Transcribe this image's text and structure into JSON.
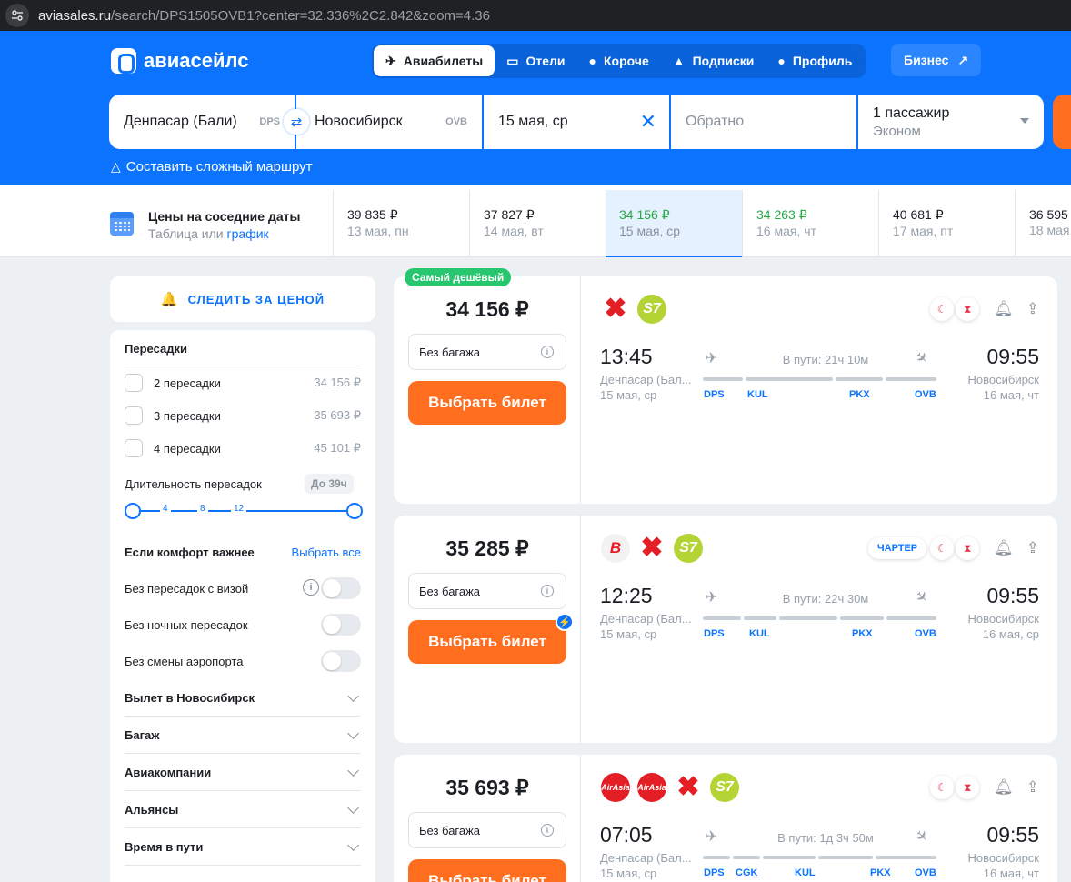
{
  "browser": {
    "domain": "aviasales.ru",
    "path": "/search/DPS1505OVB1?center=32.336%2C2.842&zoom=4.36"
  },
  "header": {
    "logo": "авиасейлс",
    "nav": [
      {
        "label": "Авиабилеты",
        "icon": "plane-icon"
      },
      {
        "label": "Отели",
        "icon": "bed-icon"
      },
      {
        "label": "Короче",
        "icon": "map-pin-icon"
      },
      {
        "label": "Подписки",
        "icon": "bell-icon"
      },
      {
        "label": "Профиль",
        "icon": "user-icon"
      }
    ],
    "business": "Бизнес"
  },
  "search": {
    "from": "Денпасар (Бали)",
    "from_code": "DPS",
    "to": "Новосибирск",
    "to_code": "OVB",
    "date": "15 мая, ср",
    "return_placeholder": "Обратно",
    "passengers": "1 пассажир",
    "class": "Эконом",
    "complex_route": "Составить сложный маршрут"
  },
  "dates": {
    "title": "Цены на соседние даты",
    "sub_table": "Таблица",
    "sub_or": "или",
    "sub_graph": "график",
    "items": [
      {
        "price": "39 835 ₽",
        "date": "13 мая, пн"
      },
      {
        "price": "37 827 ₽",
        "date": "14 мая, вт"
      },
      {
        "price": "34 156 ₽",
        "date": "15 мая, ср"
      },
      {
        "price": "34 263 ₽",
        "date": "16 мая, чт"
      },
      {
        "price": "40 681 ₽",
        "date": "17 мая, пт"
      },
      {
        "price": "36 595",
        "date": "18 мая,"
      }
    ]
  },
  "sidebar": {
    "track": "СЛЕДИТЬ ЗА ЦЕНОЙ",
    "transfers_title": "Пересадки",
    "transfers": [
      {
        "label": "2 пересадки",
        "price": "34 156 ₽"
      },
      {
        "label": "3 пересадки",
        "price": "35 693 ₽"
      },
      {
        "label": "4 пересадки",
        "price": "45 101 ₽"
      }
    ],
    "duration_label": "Длительность пересадок",
    "duration_badge": "До 39ч",
    "ticks": [
      "4",
      "8",
      "12"
    ],
    "comfort_title": "Если комфорт важнее",
    "select_all": "Выбрать все",
    "toggles": [
      "Без пересадок с визой",
      "Без ночных пересадок",
      "Без смены аэропорта"
    ],
    "accordions": [
      "Вылет в Новосибирск",
      "Багаж",
      "Авиакомпании",
      "Альянсы",
      "Время в пути"
    ]
  },
  "tickets": [
    {
      "badge": "Самый дешёвый",
      "price": "34 156 ₽",
      "bag": "Без багажа",
      "button": "Выбрать билет",
      "dep_time": "13:45",
      "arr_time": "09:55",
      "dep_city": "Денпасар (Бал...",
      "arr_city": "Новосибирск",
      "dep_date": "15 мая, ср",
      "arr_date": "16 мая, чт",
      "duration": "В пути: 21ч 10м",
      "airports": [
        "DPS",
        "KUL",
        "PKX",
        "OVB"
      ]
    },
    {
      "price": "35 285 ₽",
      "bag": "Без багажа",
      "button": "Выбрать билет",
      "charter": "ЧАРТЕР",
      "dep_time": "12:25",
      "arr_time": "09:55",
      "dep_city": "Денпасар (Бал...",
      "arr_city": "Новосибирск",
      "dep_date": "15 мая, ср",
      "arr_date": "16 мая, ср",
      "duration": "В пути: 22ч 30м",
      "airports": [
        "DPS",
        "KUL",
        "PKX",
        "OVB"
      ]
    },
    {
      "price": "35 693 ₽",
      "bag": "Без багажа",
      "button": "Выбрать билет",
      "dep_time": "07:05",
      "arr_time": "09:55",
      "dep_city": "Денпасар (Бал...",
      "arr_city": "Новосибирск",
      "dep_date": "15 мая, ср",
      "arr_date": "16 мая, чт",
      "duration": "В пути: 1д 3ч 50м",
      "airports": [
        "DPS",
        "CGK",
        "KUL",
        "PKX",
        "OVB"
      ]
    }
  ],
  "airline_logos": {
    "s7": "S7",
    "airasia": "AirAsia",
    "b": "B"
  }
}
